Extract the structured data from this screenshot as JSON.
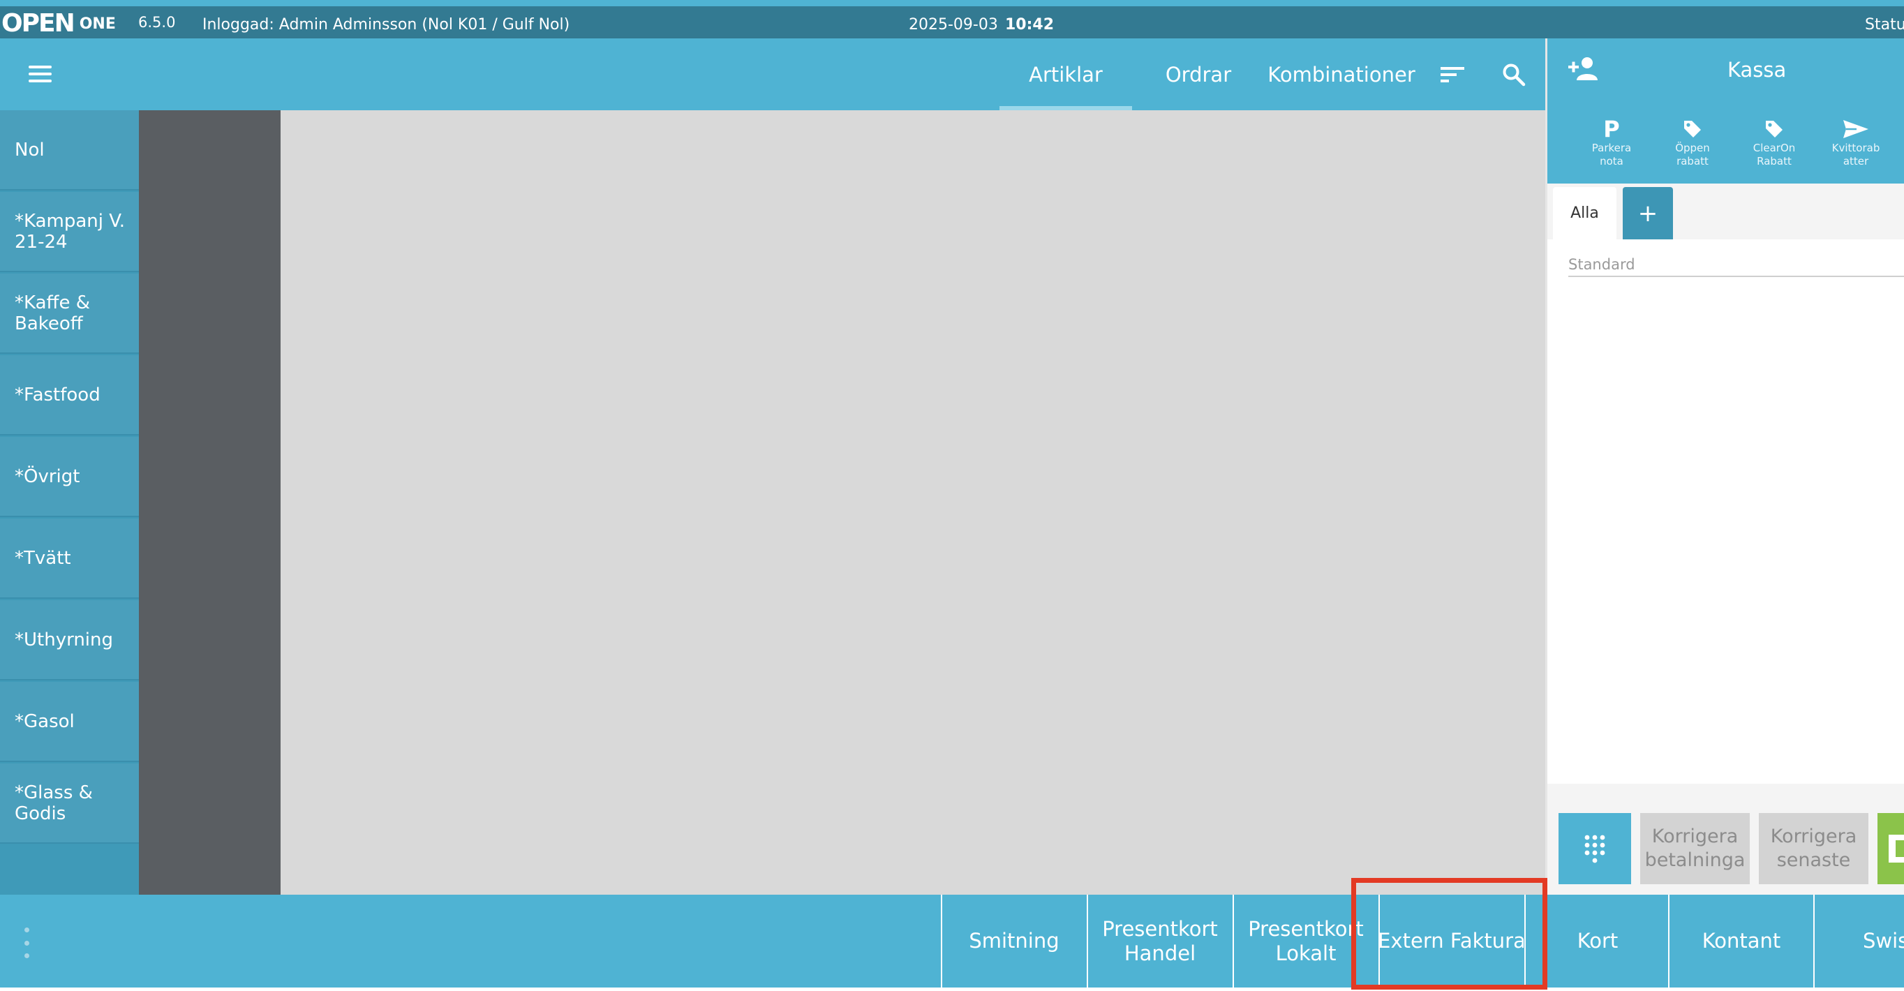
{
  "app": {
    "logo_mark": "OPEN",
    "logo_product": "ONE",
    "version": "6.5.0",
    "logged_in": "Inloggad: Admin Adminsson (Nol K01 / Gulf Nol)",
    "date": "2025-09-03",
    "time": "10:42",
    "status_label": "Status"
  },
  "header": {
    "tabs": [
      {
        "label": "Artiklar",
        "active": true
      },
      {
        "label": "Ordrar",
        "active": false
      },
      {
        "label": "Kombinationer",
        "active": false
      }
    ],
    "icons": [
      "menu-icon",
      "sort-icon",
      "search-icon"
    ]
  },
  "categories": [
    "Nol",
    "*Kampanj V. 21-24",
    "*Kaffe & Bakeoff",
    "*Fastfood",
    "*Övrigt",
    "*Tvätt",
    "*Uthyrning",
    "*Gasol",
    "*Glass & Godis"
  ],
  "register": {
    "title": "Kassa",
    "add_customer_icon": "person-add-icon",
    "quick_actions": [
      {
        "icon": "parking-icon",
        "label_line1": "Parkera",
        "label_line2": "nota"
      },
      {
        "icon": "tag-icon",
        "label_line1": "Öppen",
        "label_line2": "rabatt"
      },
      {
        "icon": "tag-icon",
        "label_line1": "ClearOn",
        "label_line2": "Rabatt"
      },
      {
        "icon": "send-icon",
        "label_line1": "Kvittorab",
        "label_line2": "atter"
      }
    ],
    "cart_tabs": {
      "all": "Alla",
      "add": "+"
    },
    "pricelist_placeholder": "Standard",
    "bottom_actions": [
      {
        "icon": "keypad-icon",
        "label_line1": "",
        "label_line2": ""
      },
      {
        "label_line1": "Korrigera",
        "label_line2": "betalninga"
      },
      {
        "label_line1": "Korrigera",
        "label_line2": "senaste"
      }
    ]
  },
  "payment_methods": [
    {
      "line1": "Smitning",
      "line2": ""
    },
    {
      "line1": "Presentkort",
      "line2": "Handel"
    },
    {
      "line1": "Presentkort",
      "line2": "Lokalt"
    },
    {
      "line1": "Extern Faktura",
      "line2": ""
    },
    {
      "line1": "Kort",
      "line2": ""
    },
    {
      "line1": "Kontant",
      "line2": ""
    },
    {
      "line1": "Swish",
      "line2": ""
    }
  ],
  "colors": {
    "primary": "#4fb3d3",
    "topbar": "#337a92",
    "highlight": "#e33a24",
    "confirm_green": "#8bc34a"
  }
}
